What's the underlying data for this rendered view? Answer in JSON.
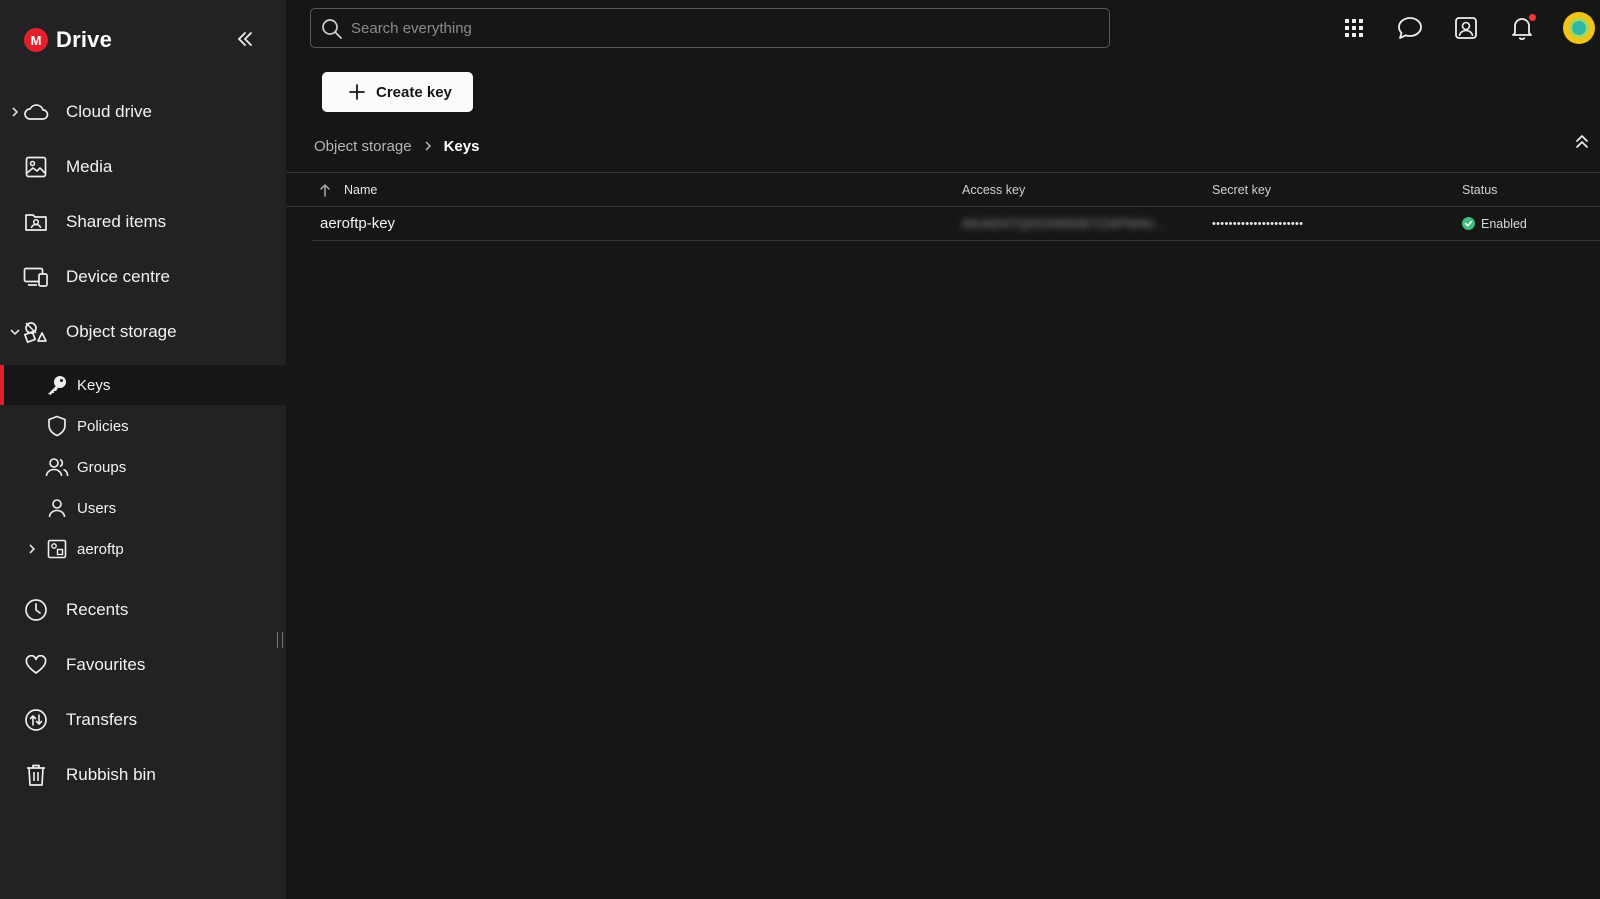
{
  "app": {
    "brand_letter": "M",
    "title": "Drive"
  },
  "sidebar": {
    "items": [
      {
        "label": "Cloud drive",
        "icon": "cloud-icon"
      },
      {
        "label": "Media",
        "icon": "image-icon"
      },
      {
        "label": "Shared items",
        "icon": "shared-folder-icon"
      },
      {
        "label": "Device centre",
        "icon": "devices-icon"
      },
      {
        "label": "Object storage",
        "icon": "object-storage-icon"
      },
      {
        "label": "Recents",
        "icon": "clock-icon"
      },
      {
        "label": "Favourites",
        "icon": "heart-icon"
      },
      {
        "label": "Transfers",
        "icon": "transfer-icon"
      },
      {
        "label": "Rubbish bin",
        "icon": "trash-icon"
      }
    ],
    "object_storage_children": [
      {
        "label": "Keys",
        "icon": "key-icon",
        "active": true
      },
      {
        "label": "Policies",
        "icon": "shield-icon"
      },
      {
        "label": "Groups",
        "icon": "group-icon"
      },
      {
        "label": "Users",
        "icon": "user-icon"
      },
      {
        "label": "aeroftp",
        "icon": "bucket-icon"
      }
    ]
  },
  "search": {
    "placeholder": "Search everything",
    "value": ""
  },
  "toolbar": {
    "create_key_label": "Create key"
  },
  "breadcrumb": {
    "parent": "Object storage",
    "current": "Keys"
  },
  "table": {
    "columns": [
      "Name",
      "Access key",
      "Secret key",
      "Status"
    ],
    "rows": [
      {
        "name": "aeroftp-key",
        "access_key": "AKIAD4TQKDXMS5EYZAPNHU...",
        "secret_key": "••••••••••••••••••••••",
        "status": "Enabled"
      }
    ]
  },
  "colors": {
    "accent": "#e0202c",
    "sidebar_bg": "#222224",
    "main_bg": "#161616",
    "status_ok": "#3ebd7c",
    "notification_dot": "#f0373a"
  }
}
